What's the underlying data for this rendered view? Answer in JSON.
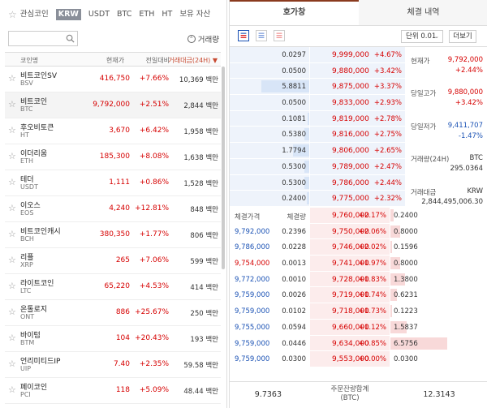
{
  "tabs": {
    "favorites": "관심코인",
    "items": [
      "KRW",
      "USDT",
      "BTC",
      "ETH",
      "HT",
      "보유 자산"
    ]
  },
  "search": {
    "placeholder": "",
    "sort_label": "거래량"
  },
  "coin_header": {
    "name": "코인명",
    "price": "현재가",
    "change": "전일대비",
    "volume": "거래대금(24H) ▼"
  },
  "coins": [
    {
      "name": "비트코인SV",
      "symbol": "BSV",
      "price": "416,750",
      "change": "+7.66%",
      "volume": "10,369 백만"
    },
    {
      "name": "비트코인",
      "symbol": "BTC",
      "price": "9,792,000",
      "change": "+2.51%",
      "volume": "2,844 백만"
    },
    {
      "name": "후오비토큰",
      "symbol": "HT",
      "price": "3,670",
      "change": "+6.42%",
      "volume": "1,958 백만"
    },
    {
      "name": "이더리움",
      "symbol": "ETH",
      "price": "185,300",
      "change": "+8.08%",
      "volume": "1,638 백만"
    },
    {
      "name": "테더",
      "symbol": "USDT",
      "price": "1,111",
      "change": "+0.86%",
      "volume": "1,528 백만"
    },
    {
      "name": "이오스",
      "symbol": "EOS",
      "price": "4,240",
      "change": "+12.81%",
      "volume": "848 백만"
    },
    {
      "name": "비트코인캐시",
      "symbol": "BCH",
      "price": "380,350",
      "change": "+1.77%",
      "volume": "806 백만"
    },
    {
      "name": "리플",
      "symbol": "XRP",
      "price": "265",
      "change": "+7.06%",
      "volume": "599 백만"
    },
    {
      "name": "라이트코인",
      "symbol": "LTC",
      "price": "65,220",
      "change": "+4.53%",
      "volume": "414 백만"
    },
    {
      "name": "온톨로지",
      "symbol": "ONT",
      "price": "886",
      "change": "+25.67%",
      "volume": "250 백만"
    },
    {
      "name": "바이텀",
      "symbol": "BTM",
      "price": "104",
      "change": "+20.43%",
      "volume": "193 백만"
    },
    {
      "name": "언리미티드IP",
      "symbol": "UIP",
      "price": "7.40",
      "change": "+2.35%",
      "volume": "59.58 백만"
    },
    {
      "name": "페이코인",
      "symbol": "PCI",
      "price": "118",
      "change": "+5.09%",
      "volume": "48.44 백만"
    }
  ],
  "right_tabs": [
    "호가창",
    "체결 내역"
  ],
  "toolbar": {
    "unit": "단위 0.01",
    "more": "더보기"
  },
  "asks": [
    {
      "qty": "0.0297",
      "qty_frac": 0.0,
      "price": "9,999,000",
      "change": "+4.67%"
    },
    {
      "qty": "0.0500",
      "qty_frac": 0.0,
      "price": "9,880,000",
      "change": "+3.42%"
    },
    {
      "qty": "5.8811",
      "qty_frac": 0.6,
      "price": "9,875,000",
      "change": "+3.37%"
    },
    {
      "qty": "0.0500",
      "qty_frac": 0.0,
      "price": "9,833,000",
      "change": "+2.93%"
    },
    {
      "qty": "0.1081",
      "qty_frac": 0.02,
      "price": "9,819,000",
      "change": "+2.78%"
    },
    {
      "qty": "0.5380",
      "qty_frac": 0.06,
      "price": "9,816,000",
      "change": "+2.75%"
    },
    {
      "qty": "1.7794",
      "qty_frac": 0.2,
      "price": "9,806,000",
      "change": "+2.65%"
    },
    {
      "qty": "0.5300",
      "qty_frac": 0.06,
      "price": "9,789,000",
      "change": "+2.47%"
    },
    {
      "qty": "0.5300",
      "qty_frac": 0.06,
      "price": "9,786,000",
      "change": "+2.44%"
    },
    {
      "qty": "0.2400",
      "qty_frac": 0.03,
      "price": "9,775,000",
      "change": "+2.32%"
    }
  ],
  "info": {
    "current_label": "현재가",
    "current_value": "9,792,000",
    "current_change": "+2.44%",
    "high_label": "당일고가",
    "high_value": "9,880,000",
    "high_change": "+3.42%",
    "low_label": "당일저가",
    "low_value": "9,411,707",
    "low_change": "-1.47%",
    "vol_label": "거래량(24H)",
    "vol_unit": "BTC",
    "vol_value": "295.0364",
    "amt_label": "거래대금",
    "amt_unit": "KRW",
    "amt_value": "2,844,495,006.30"
  },
  "trade_header": {
    "price": "체결가격",
    "qty": "체결량"
  },
  "bids": [
    {
      "tprice": "",
      "tqty": "",
      "price": "9,760,000",
      "change": "+2.17%",
      "qty": "0.2400",
      "qty_frac": 0.03
    },
    {
      "tprice": "9,792,000",
      "tqty": "0.2396",
      "price": "9,750,000",
      "change": "+2.06%",
      "qty": "0.8000",
      "qty_frac": 0.1
    },
    {
      "tprice": "9,786,000",
      "tqty": "0.0228",
      "price": "9,746,000",
      "change": "+2.02%",
      "qty": "0.1596",
      "qty_frac": 0.02
    },
    {
      "tprice": "9,754,000",
      "tqty": "0.0013",
      "price": "9,741,000",
      "change": "+1.97%",
      "qty": "0.8000",
      "qty_frac": 0.1
    },
    {
      "tprice": "9,772,000",
      "tqty": "0.0010",
      "price": "9,728,000",
      "change": "+1.83%",
      "qty": "1.3800",
      "qty_frac": 0.15
    },
    {
      "tprice": "9,759,000",
      "tqty": "0.0026",
      "price": "9,719,000",
      "change": "+1.74%",
      "qty": "0.6231",
      "qty_frac": 0.07
    },
    {
      "tprice": "9,759,000",
      "tqty": "0.0102",
      "price": "9,718,000",
      "change": "+1.73%",
      "qty": "0.1223",
      "qty_frac": 0.02
    },
    {
      "tprice": "9,755,000",
      "tqty": "0.0594",
      "price": "9,660,000",
      "change": "+1.12%",
      "qty": "1.5837",
      "qty_frac": 0.17
    },
    {
      "tprice": "9,759,000",
      "tqty": "0.0446",
      "price": "9,634,000",
      "change": "+0.85%",
      "qty": "6.5756",
      "qty_frac": 0.58
    },
    {
      "tprice": "9,759,000",
      "tqty": "0.0300",
      "price": "9,553,000",
      "change": "+0.00%",
      "qty": "0.0300",
      "qty_frac": 0.0
    }
  ],
  "footer": {
    "ask_total": "9.7363",
    "label_line1": "주문잔량합계",
    "label_line2": "(BTC)",
    "bid_total": "12.3143"
  },
  "colors": {
    "up": "#d60000",
    "down": "#1c53b5",
    "accent": "#8a3a1e",
    "ask_bg": "#eef3fb",
    "bid_bg": "#fcecec"
  }
}
